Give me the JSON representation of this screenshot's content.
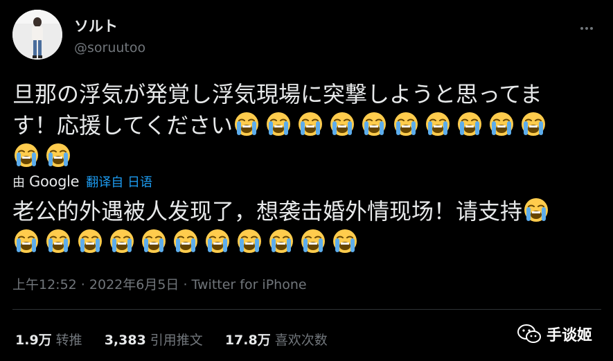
{
  "author": {
    "display_name": "ソルト",
    "handle": "@soruutoo"
  },
  "tweet": {
    "original_lines": [
      "旦那の浮気が発覚し浮気現場に突撃しようと思ってま",
      "す！応援してください"
    ],
    "translated_lines": [
      "老公的外遇被人发现了，想袭击婚外情现场！请支持"
    ],
    "emoji_name": "loudly-crying-face-emoji",
    "original_emoji_counts": [
      0,
      10,
      2
    ],
    "translated_emoji_counts": [
      1,
      11
    ]
  },
  "translation": {
    "by_label": "由",
    "google_label": "Google",
    "link_label": "翻译自 日语"
  },
  "meta": {
    "time": "上午12:52",
    "separator1": " · ",
    "date": "2022年6月5日",
    "separator2": " · ",
    "source": "Twitter for iPhone"
  },
  "stats": {
    "retweets_count": "1.9万",
    "retweets_label": "转推",
    "quotes_count": "3,383",
    "quotes_label": "引用推文",
    "likes_count": "17.8万",
    "likes_label": "喜欢次数"
  },
  "watermark": {
    "text": "手谈姬"
  },
  "colors": {
    "background": "#000000",
    "text": "#e7e9ea",
    "secondary": "#71767b",
    "link": "#1d9bf0",
    "emoji_face": "#ffcc4d",
    "emoji_tears": "#5dadec"
  }
}
